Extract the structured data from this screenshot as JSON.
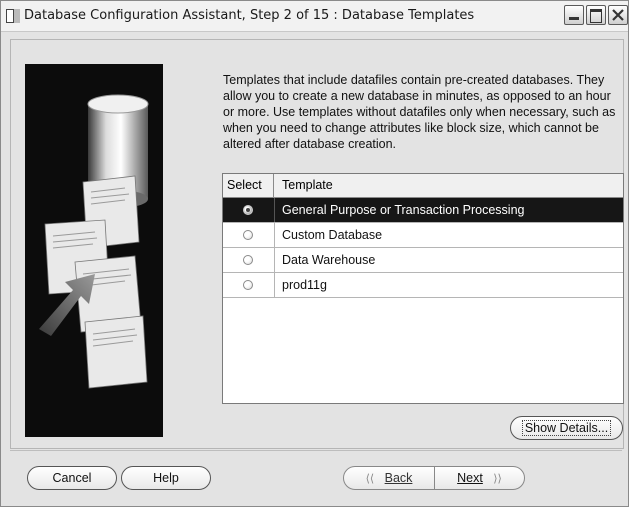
{
  "window": {
    "title": "Database Configuration Assistant, Step 2 of 15 : Database Templates"
  },
  "description": "Templates that include datafiles contain pre-created databases. They allow you to create a new database in minutes, as opposed to an hour or more. Use templates without datafiles only when necessary, such as when you need to change attributes like block size, which cannot be altered after database creation.",
  "templates_table": {
    "columns": [
      "Select",
      "Template"
    ],
    "rows": [
      {
        "label": "General Purpose or Transaction Processing",
        "selected": true
      },
      {
        "label": "Custom Database",
        "selected": false
      },
      {
        "label": "Data Warehouse",
        "selected": false
      },
      {
        "label": "prod11g",
        "selected": false
      }
    ]
  },
  "buttons": {
    "show_details": "Show Details...",
    "cancel": "Cancel",
    "help": "Help",
    "back": "Back",
    "next": "Next"
  },
  "colors": {
    "window_background": "#e3e3e3",
    "selected_row": "#161616",
    "side_panel": "#0c0c0c"
  }
}
